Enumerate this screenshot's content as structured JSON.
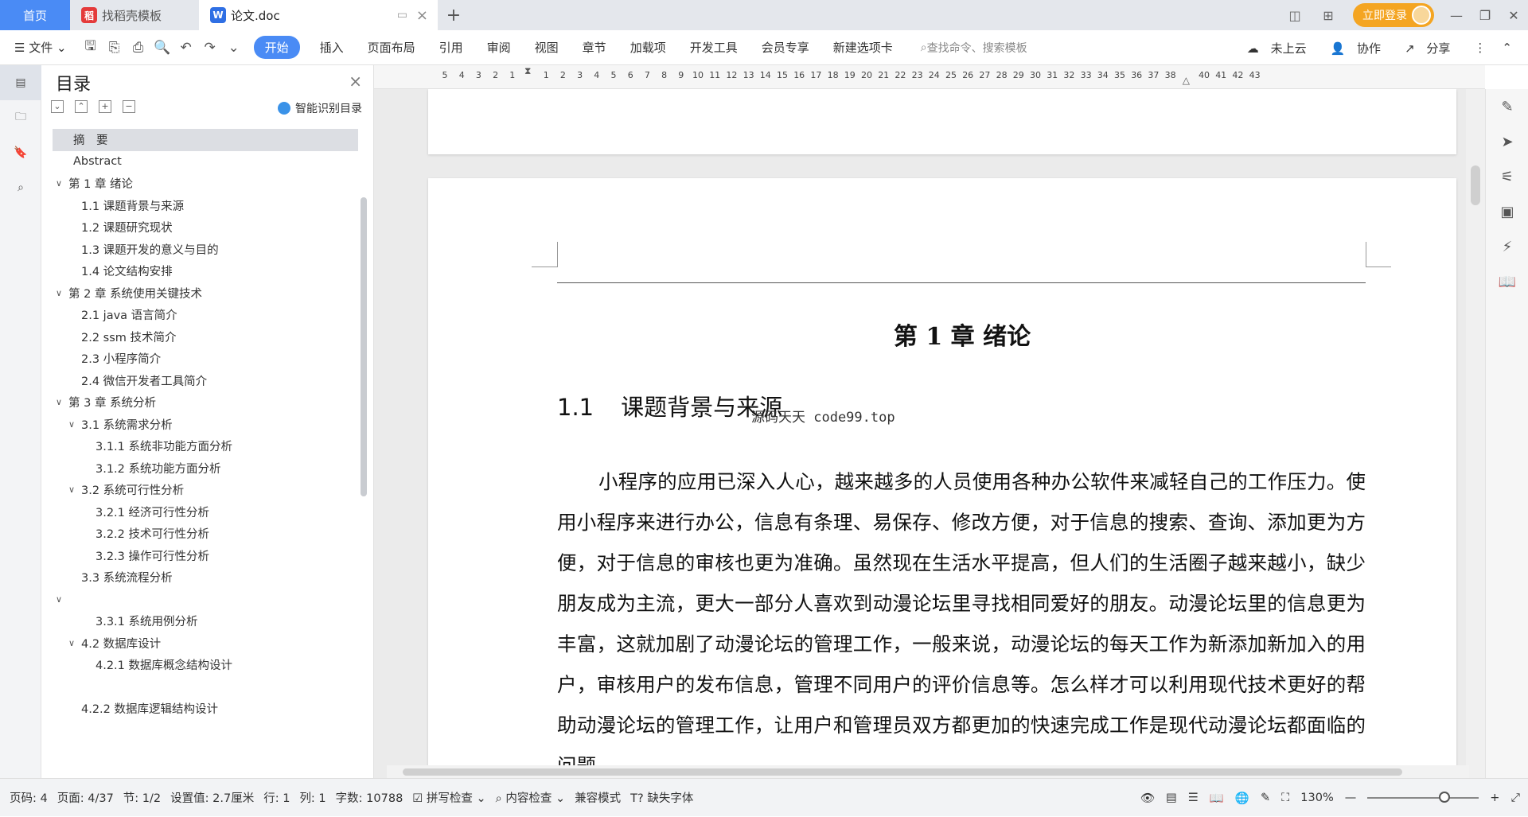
{
  "tabs": {
    "home": "首页",
    "template": "找稻壳模板",
    "doc": "论文.doc"
  },
  "window": {
    "login": "立即登录"
  },
  "ribbon": {
    "file": "文件",
    "items": [
      "开始",
      "插入",
      "页面布局",
      "引用",
      "审阅",
      "视图",
      "章节",
      "加载项",
      "开发工具",
      "会员专享",
      "新建选项卡"
    ],
    "search_placeholder": "查找命令、搜索模板",
    "cloud": "未上云",
    "collab": "协作",
    "share": "分享"
  },
  "toc": {
    "title": "目录",
    "smart": "智能识别目录",
    "items": [
      {
        "label": "摘　要",
        "level": 1,
        "chevron": false,
        "selected": true
      },
      {
        "label": "Abstract",
        "level": 1,
        "chevron": false
      },
      {
        "label": "第 1 章  绪论",
        "level": 0,
        "chevron": true
      },
      {
        "label": "1.1    课题背景与来源",
        "level": 2,
        "chevron": false
      },
      {
        "label": "1.2  课题研究现状",
        "level": 2,
        "chevron": false
      },
      {
        "label": "1.3 课题开发的意义与目的",
        "level": 2,
        "chevron": false
      },
      {
        "label": "1.4 论文结构安排",
        "level": 2,
        "chevron": false
      },
      {
        "label": "第 2 章  系统使用关键技术",
        "level": 0,
        "chevron": true
      },
      {
        "label": "2.1 java 语言简介",
        "level": 2,
        "chevron": false
      },
      {
        "label": "2.2 ssm 技术简介",
        "level": 2,
        "chevron": false
      },
      {
        "label": "2.3  小程序简介",
        "level": 2,
        "chevron": false
      },
      {
        "label": "2.4  微信开发者工具简介",
        "level": 2,
        "chevron": false
      },
      {
        "label": "第 3 章  系统分析",
        "level": 0,
        "chevron": true
      },
      {
        "label": "3.1  系统需求分析",
        "level": 1,
        "chevron": true
      },
      {
        "label": "3.1.1 系统非功能方面分析",
        "level": 3,
        "chevron": false
      },
      {
        "label": "3.1.2 系统功能方面分析",
        "level": 3,
        "chevron": false
      },
      {
        "label": "3.2 系统可行性分析",
        "level": 1,
        "chevron": true
      },
      {
        "label": "3.2.1  经济可行性分析",
        "level": 3,
        "chevron": false
      },
      {
        "label": "3.2.2    技术可行性分析",
        "level": 3,
        "chevron": false
      },
      {
        "label": "3.2.3    操作可行性分析",
        "level": 3,
        "chevron": false
      },
      {
        "label": "3.3 系统流程分析",
        "level": 2,
        "chevron": false
      },
      {
        "label": "",
        "level": 0,
        "chevron": true
      },
      {
        "label": "3.3.1 系统用例分析",
        "level": 3,
        "chevron": false
      },
      {
        "label": "4.2 数据库设计",
        "level": 1,
        "chevron": true
      },
      {
        "label": "4.2.1 数据库概念结构设计",
        "level": 3,
        "chevron": false
      },
      {
        "label": "",
        "level": 3,
        "chevron": false
      },
      {
        "label": "4.2.2 数据库逻辑结构设计",
        "level": 2,
        "chevron": false
      }
    ]
  },
  "ruler": {
    "ticks": [
      "5",
      "4",
      "3",
      "2",
      "1",
      "",
      "1",
      "2",
      "3",
      "4",
      "5",
      "6",
      "7",
      "8",
      "9",
      "10",
      "11",
      "12",
      "13",
      "14",
      "15",
      "16",
      "17",
      "18",
      "19",
      "20",
      "21",
      "22",
      "23",
      "24",
      "25",
      "26",
      "27",
      "28",
      "29",
      "30",
      "31",
      "32",
      "33",
      "34",
      "35",
      "36",
      "37",
      "38",
      "",
      "40",
      "41",
      "42",
      "43"
    ]
  },
  "document": {
    "chapter_title": "第 1 章  绪论",
    "section_num": "1.1",
    "section_title": "课题背景与来源",
    "watermark": "源码天天 code99.top",
    "paragraph": "小程序的应用已深入人心，越来越多的人员使用各种办公软件来减轻自己的工作压力。使用小程序来进行办公，信息有条理、易保存、修改方便，对于信息的搜索、查询、添加更为方便，对于信息的审核也更为准确。虽然现在生活水平提高，但人们的生活圈子越来越小，缺少朋友成为主流，更大一部分人喜欢到动漫论坛里寻找相同爱好的朋友。动漫论坛里的信息更为丰富，这就加剧了动漫论坛的管理工作，一般来说，动漫论坛的每天工作为新添加新加入的用户，审核用户的发布信息，管理不同用户的评价信息等。怎么样才可以利用现代技术更好的帮助动漫论坛的管理工作，让用户和管理员双方都更加的快速完成工作是现代动漫论坛都面临的问题。"
  },
  "status": {
    "page_code": "页码: 4",
    "page": "页面: 4/37",
    "section": "节: 1/2",
    "setting": "设置值: 2.7厘米",
    "row": "行: 1",
    "col": "列: 1",
    "words": "字数: 10788",
    "spell": "拼写检查",
    "content_check": "内容检查",
    "compat": "兼容模式",
    "missing_font": "缺失字体",
    "zoom": "130%"
  }
}
